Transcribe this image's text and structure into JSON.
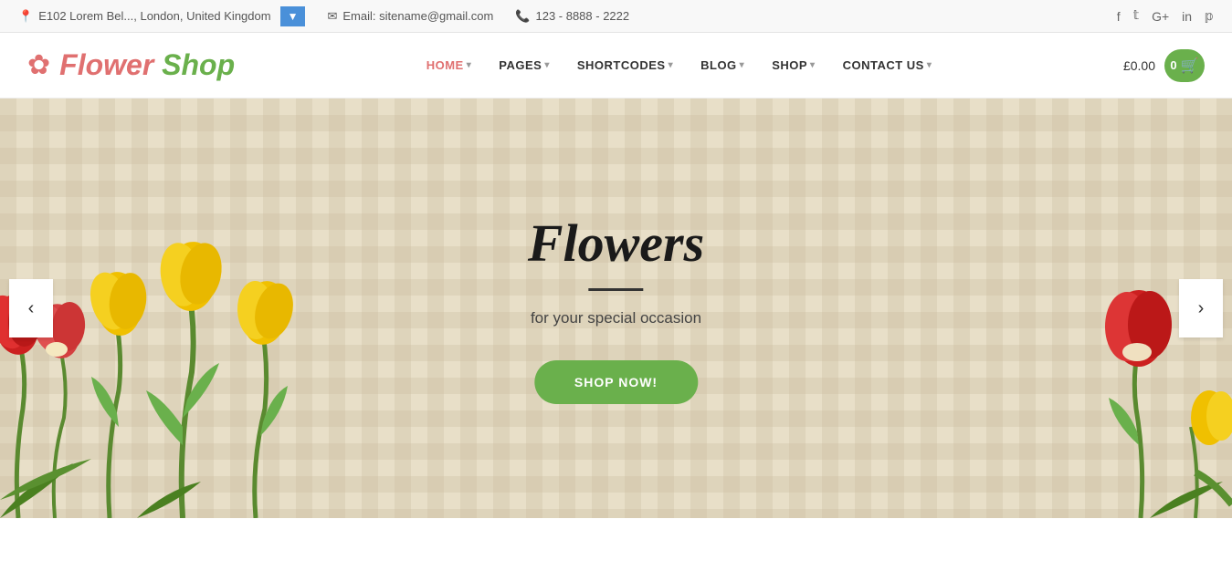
{
  "topbar": {
    "address": "E102 Lorem Bel..., London, United Kingdom",
    "address_icon": "📍",
    "email_label": "Email: sitename@gmail.com",
    "email_icon": "✉",
    "phone": "123 - 8888 - 2222",
    "phone_icon": "📞"
  },
  "social": {
    "facebook": "f",
    "twitter": "t",
    "googleplus": "G+",
    "linkedin": "in",
    "pinterest": "p"
  },
  "header": {
    "logo_flower": "Flower ",
    "logo_shop": "Shop",
    "nav_items": [
      {
        "label": "HOME",
        "active": true,
        "has_dropdown": true
      },
      {
        "label": "PAGES",
        "active": false,
        "has_dropdown": true
      },
      {
        "label": "SHORTCODES",
        "active": false,
        "has_dropdown": true
      },
      {
        "label": "BLOG",
        "active": false,
        "has_dropdown": true
      },
      {
        "label": "SHOP",
        "active": false,
        "has_dropdown": true
      },
      {
        "label": "CONTACT US",
        "active": false,
        "has_dropdown": true
      }
    ],
    "cart_price": "£0.00",
    "cart_count": "0"
  },
  "hero": {
    "title": "Flowers",
    "subtitle": "for your special occasion",
    "button_label": "SHOP NOW!",
    "prev_arrow": "‹",
    "next_arrow": "›"
  }
}
